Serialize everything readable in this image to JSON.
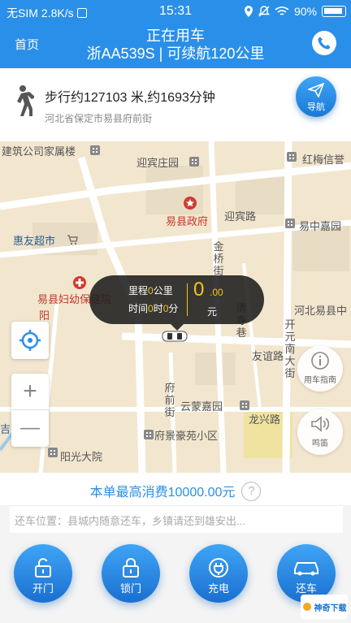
{
  "status_bar": {
    "carrier": "无SIM",
    "speed": "2.8K/s",
    "time": "15:31",
    "battery": "90%"
  },
  "header": {
    "home_label": "首页",
    "title_line1": "正在用车",
    "title_line2": "浙AA539S | 可续航120公里"
  },
  "walking": {
    "summary": "步行约127103 米,约1693分钟",
    "address": "河北省保定市易县府前街",
    "nav_label": "导航"
  },
  "map": {
    "labels": {
      "l1": "建筑公司家属楼",
      "l2": "迎宾庄园",
      "l3": "红梅信誉",
      "l4": "易县政府",
      "l5": "迎宾路",
      "l6": "易中嘉园",
      "l7": "惠友超市",
      "l8": "金桥街",
      "l9": "易县妇幼保健院",
      "l10": "河北易县中",
      "l11": "开元南大街",
      "l12": "友谊路",
      "l13": "清寺巷",
      "l14": "府前街",
      "l15": "云蒙嘉园",
      "l16": "龙兴路",
      "l17": "府景豪苑小区",
      "l18": "阳光大院",
      "l19": "阳",
      "l20": "吉"
    },
    "popup": {
      "mileage_label": "里程",
      "mileage_value": "0",
      "mileage_unit": "公里",
      "time_label": "时间",
      "hours": "0",
      "hour_unit": "时",
      "minutes": "0",
      "minute_unit": "分",
      "amount_int": "0",
      "amount_dec": ".00",
      "amount_unit": "元"
    },
    "guide_label": "用车指南",
    "horn_label": "鸣笛",
    "zoom_in": "+",
    "zoom_out": "—"
  },
  "cost": {
    "text": "本单最高消费10000.00元",
    "help": "?"
  },
  "return_location": "还车位置：县城内随意还车，乡镇请还到雄安出...",
  "actions": [
    {
      "label": "开门"
    },
    {
      "label": "锁门"
    },
    {
      "label": "充电"
    },
    {
      "label": "还车"
    }
  ],
  "watermark": "神奇下载",
  "colors": {
    "primary": "#2a8fe8",
    "accent": "#f5c518",
    "map_bg": "#f2e6cf"
  }
}
